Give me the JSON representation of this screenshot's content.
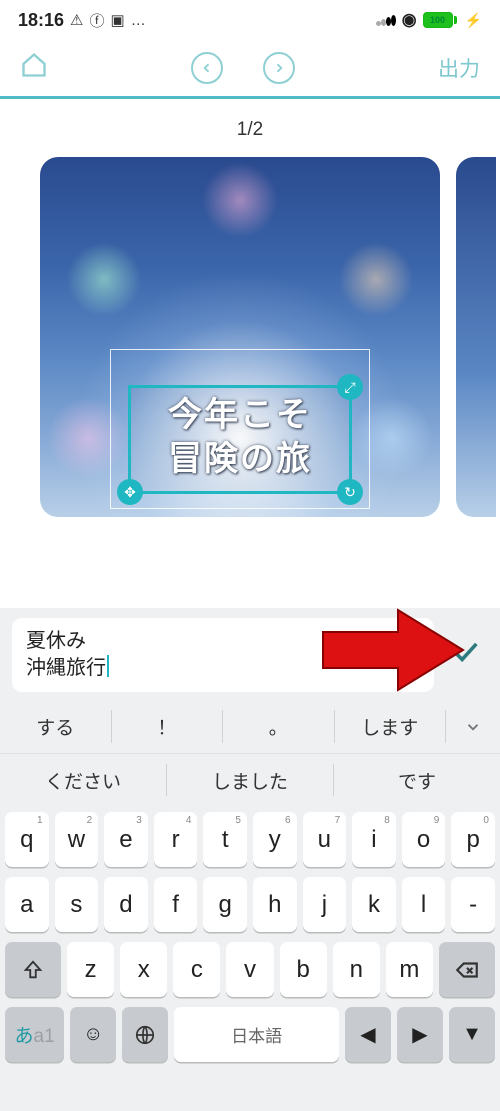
{
  "status": {
    "time": "18:16",
    "battery_pct": "100"
  },
  "nav": {
    "export_label": "出力"
  },
  "canvas": {
    "page_indicator": "1/2",
    "text_line1": "今年こそ",
    "text_line2": "冒険の旅"
  },
  "input": {
    "line1": "夏休み",
    "line2": "沖縄旅行"
  },
  "suggestions_row1": [
    "する",
    "！",
    "。",
    "します"
  ],
  "suggestions_row2": [
    "ください",
    "しました",
    "です"
  ],
  "keyboard": {
    "row1": [
      {
        "k": "q",
        "s": "1"
      },
      {
        "k": "w",
        "s": "2"
      },
      {
        "k": "e",
        "s": "3"
      },
      {
        "k": "r",
        "s": "4"
      },
      {
        "k": "t",
        "s": "5"
      },
      {
        "k": "y",
        "s": "6"
      },
      {
        "k": "u",
        "s": "7"
      },
      {
        "k": "i",
        "s": "8"
      },
      {
        "k": "o",
        "s": "9"
      },
      {
        "k": "p",
        "s": "0"
      }
    ],
    "row2": [
      "a",
      "s",
      "d",
      "f",
      "g",
      "h",
      "j",
      "k",
      "l",
      "-"
    ],
    "row3": [
      "z",
      "x",
      "c",
      "v",
      "b",
      "n",
      "m"
    ],
    "space_label": "日本語",
    "mode_kana": "あ",
    "mode_alpha": "a",
    "mode_num": "1"
  }
}
